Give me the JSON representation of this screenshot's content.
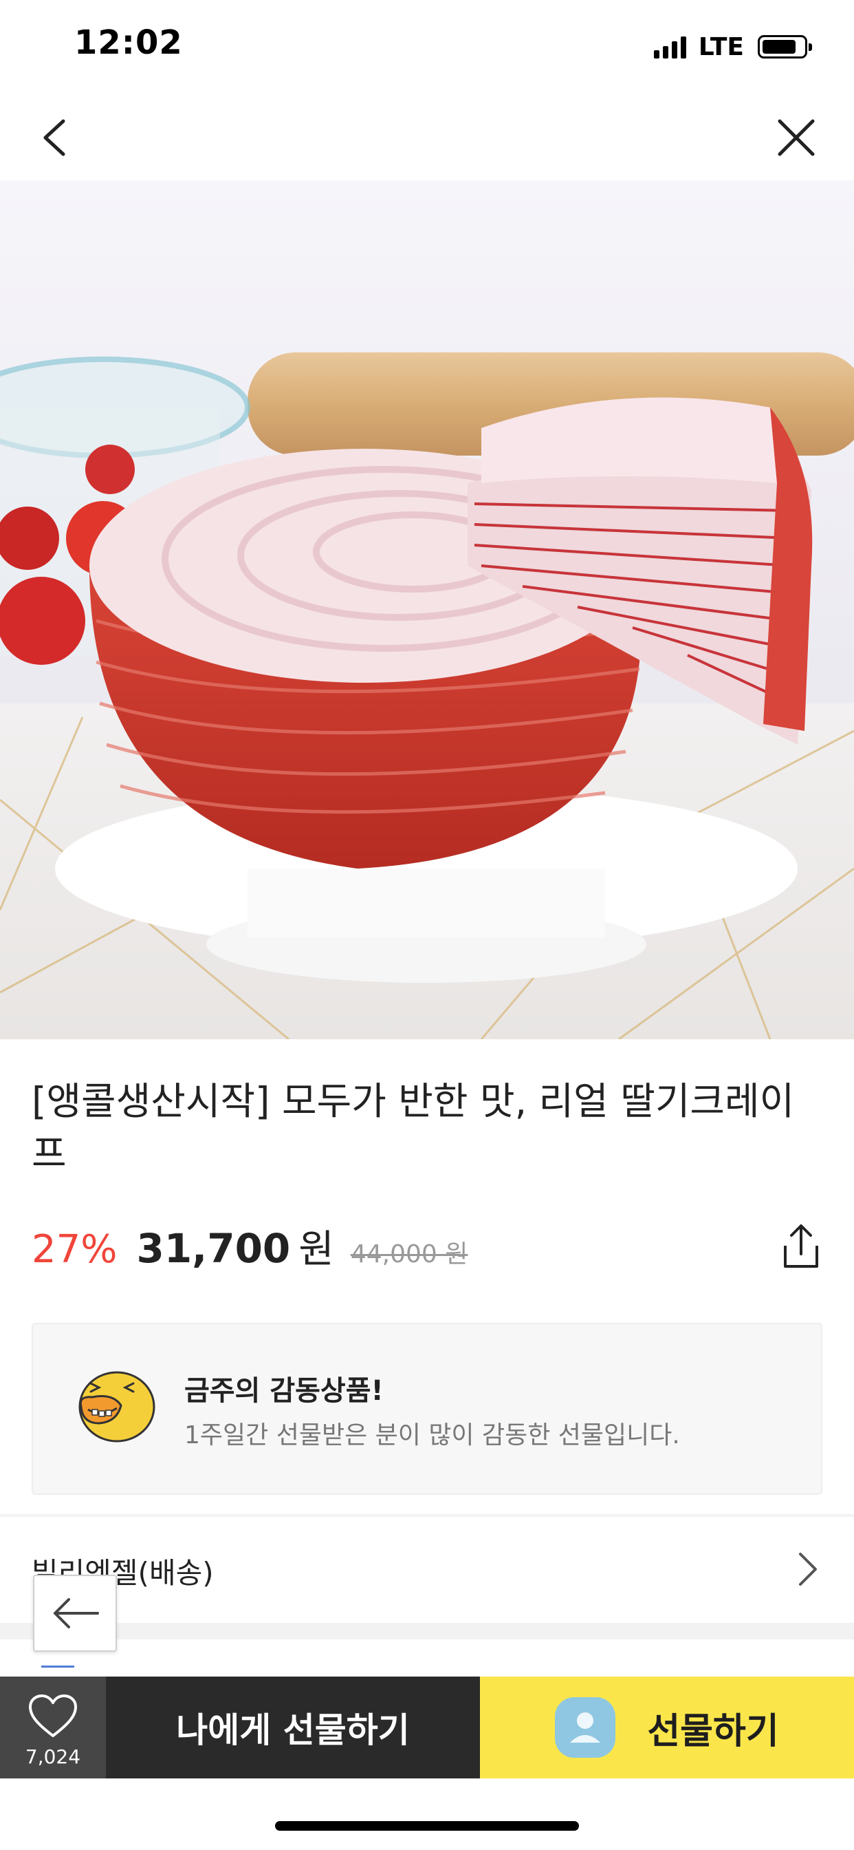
{
  "status_bar": {
    "time": "12:02",
    "network": "LTE"
  },
  "nav": {
    "back_icon": "chevron-left-icon",
    "close_icon": "close-icon"
  },
  "product": {
    "image_alt": "strawberry crepe cake",
    "title": "[앵콜생산시작] 모두가 반한 맛, 리얼 딸기크레이프",
    "discount": "27%",
    "price": "31,700",
    "currency": "원",
    "original_price": "44,000 원"
  },
  "award": {
    "title": "금주의 감동상품!",
    "subtitle": "1주일간 선물받은 분이 많이 감동한 선물입니다."
  },
  "seller": {
    "name": "빌리엔젤(배송)"
  },
  "bottom_bar": {
    "like_count": "7,024",
    "self_gift_label": "나에게 선물하기",
    "gift_label": "선물하기"
  },
  "colors": {
    "discount": "#f0453a",
    "gift_button": "#fae64b",
    "self_gift_button": "#2a2a2a",
    "like_button": "#464646"
  }
}
